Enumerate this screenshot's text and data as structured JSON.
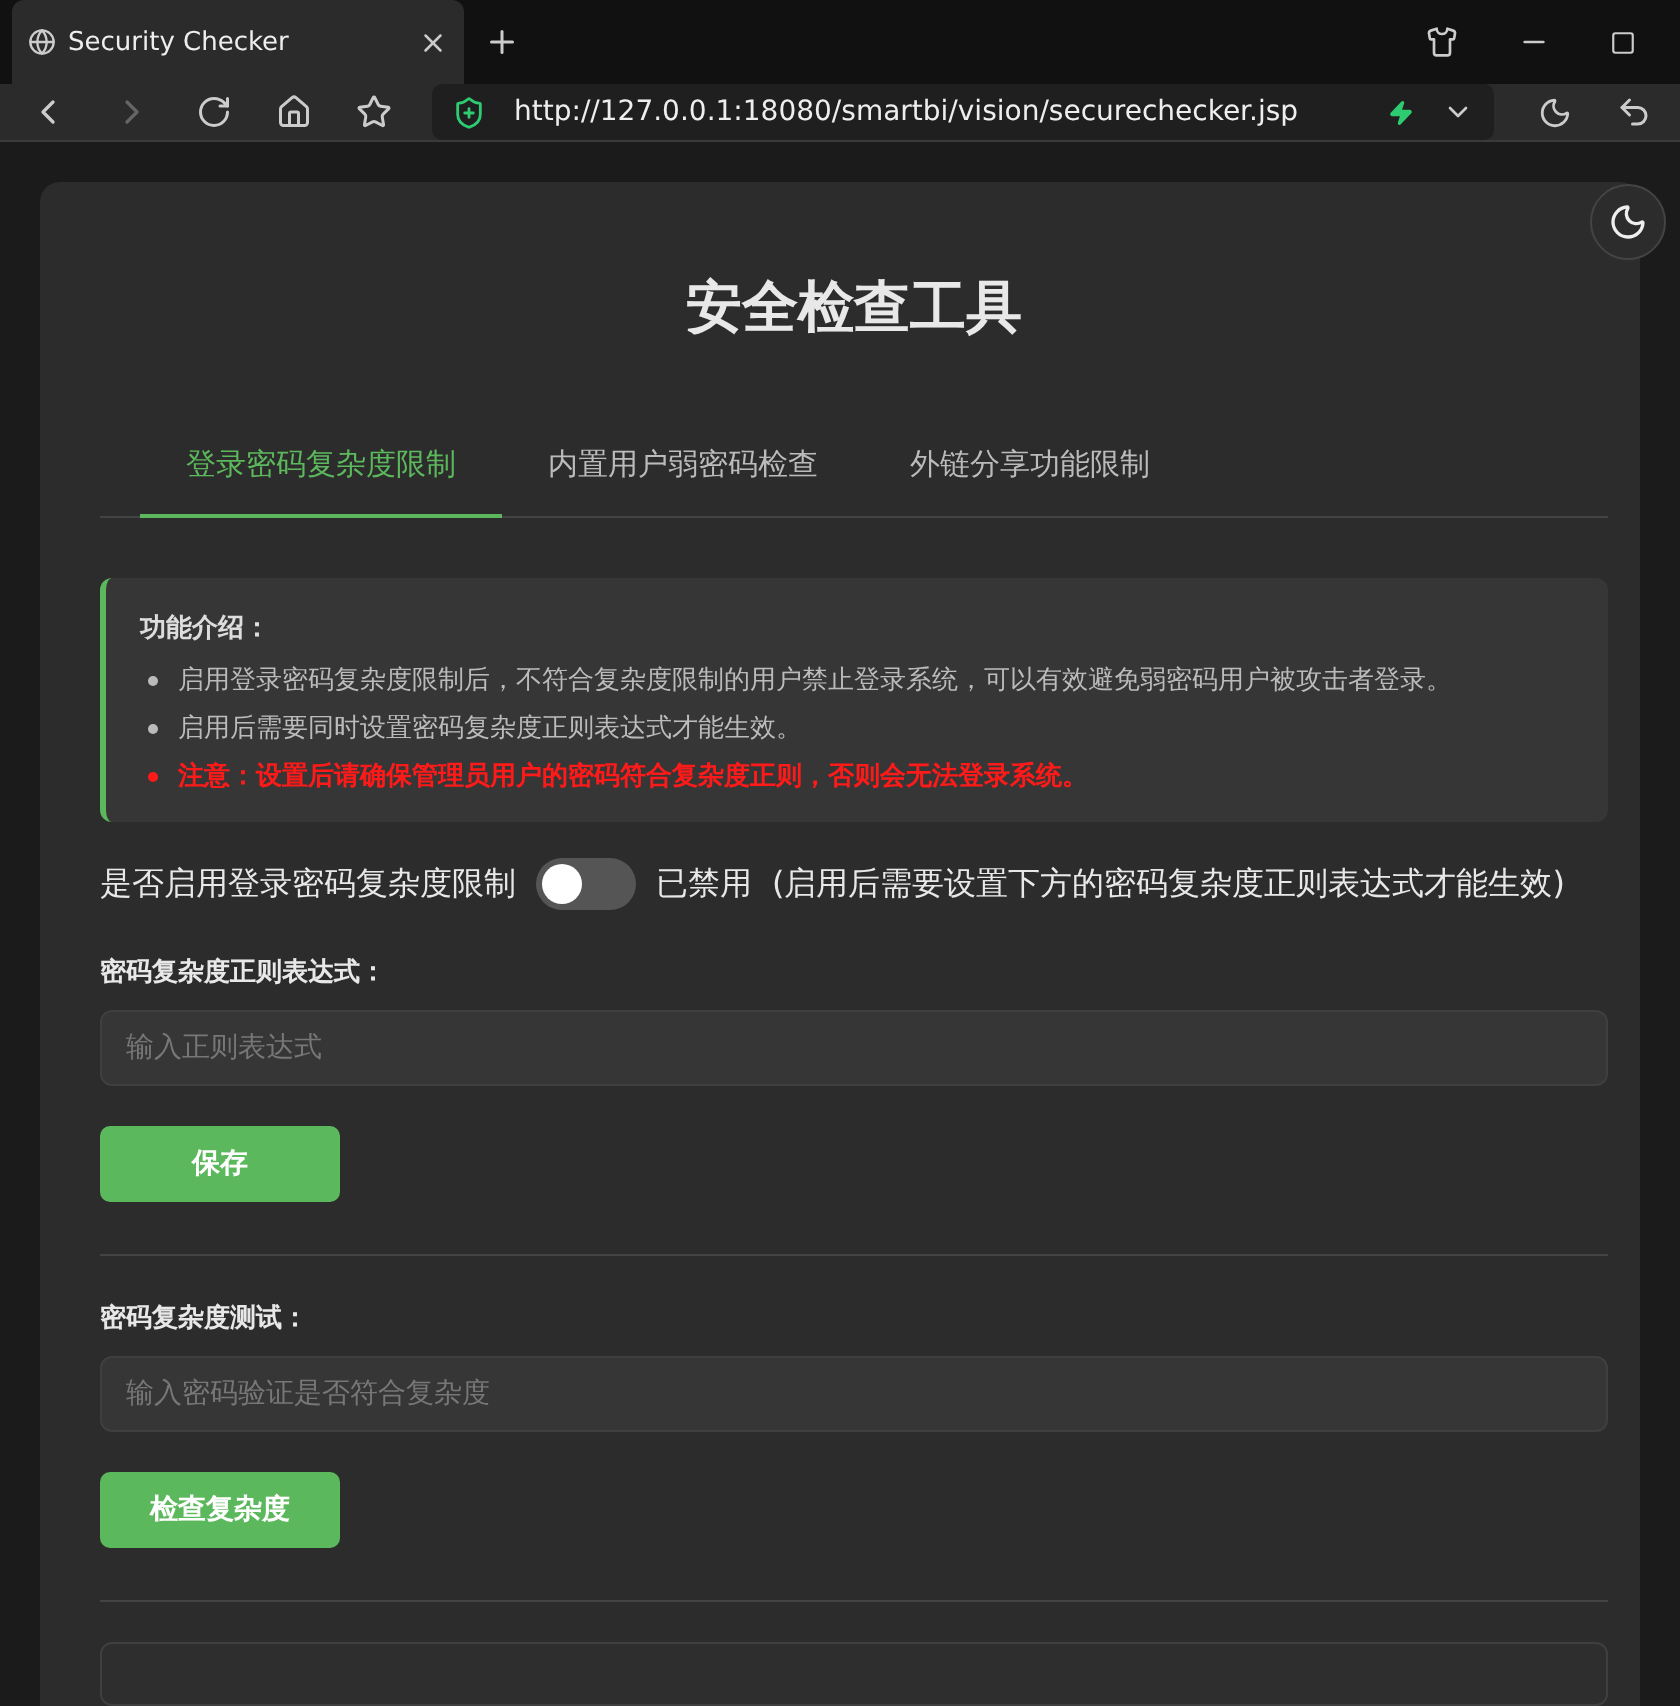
{
  "browser": {
    "tab_title": "Security Checker",
    "url": "http://127.0.0.1:18080/smartbi/vision/securechecker.jsp"
  },
  "page": {
    "title": "安全检查工具",
    "tabs": [
      {
        "label": "登录密码复杂度限制",
        "selected": true
      },
      {
        "label": "内置用户弱密码检查",
        "selected": false
      },
      {
        "label": "外链分享功能限制",
        "selected": false
      }
    ],
    "intro": {
      "heading": "功能介绍：",
      "items": [
        {
          "kind": "normal",
          "text": "启用登录密码复杂度限制后，不符合复杂度限制的用户禁止登录系统，可以有效避免弱密码用户被攻击者登录。"
        },
        {
          "kind": "normal",
          "text": "启用后需要同时设置密码复杂度正则表达式才能生效。"
        },
        {
          "kind": "warning",
          "text": "注意：设置后请确保管理员用户的密码符合复杂度正则，否则会无法登录系统。"
        }
      ]
    },
    "toggle": {
      "label": "是否启用登录密码复杂度限制",
      "on": false,
      "status": "已禁用",
      "hint": "(启用后需要设置下方的密码复杂度正则表达式才能生效)"
    },
    "sections": [
      {
        "label": "密码复杂度正则表达式：",
        "placeholder": "输入正则表达式",
        "button": "保存"
      },
      {
        "label": "密码复杂度测试：",
        "placeholder": "输入密码验证是否符合复杂度",
        "button": "检查复杂度"
      }
    ]
  }
}
